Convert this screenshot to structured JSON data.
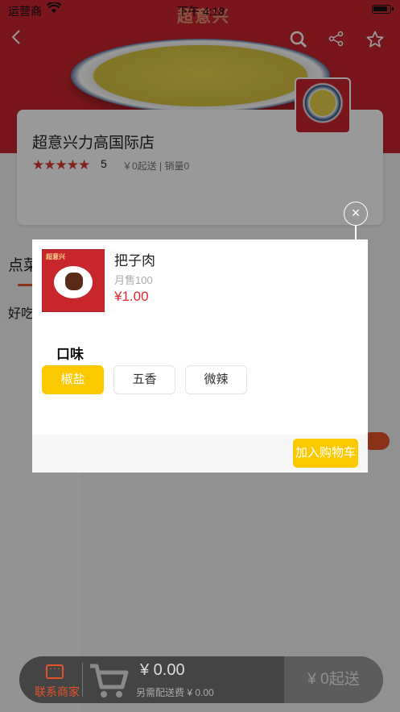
{
  "status_bar": {
    "carrier": "运营商",
    "time": "下午 4:18"
  },
  "hero": {
    "banner_text": "超意兴"
  },
  "store": {
    "name": "超意兴力高国际店",
    "rating": "5",
    "stars": "★★★★★",
    "min_order": "￥0起送",
    "sales": "销量0"
  },
  "background": {
    "tab_label": "点菜",
    "sub_label": "好吃"
  },
  "popup": {
    "close_symbol": "×",
    "item": {
      "name": "把子肉",
      "monthly_sales": "月售100",
      "price": "¥1.00",
      "image_logo": "超意兴"
    },
    "spec_title": "口味",
    "options": [
      {
        "label": "椒盐",
        "selected": true
      },
      {
        "label": "五香",
        "selected": false
      },
      {
        "label": "微辣",
        "selected": false
      }
    ],
    "add_to_cart": "加入购物车"
  },
  "cart_bar": {
    "contact_label": "联系商家",
    "total": "¥ 0.00",
    "delivery_fee": "另需配送费 ¥ 0.00",
    "min_order_button": "¥ 0起送"
  },
  "colors": {
    "brand_red": "#c8262d",
    "accent_yellow": "#fcc900",
    "price_red": "#e0252b",
    "accent_orange": "#e4522b"
  }
}
